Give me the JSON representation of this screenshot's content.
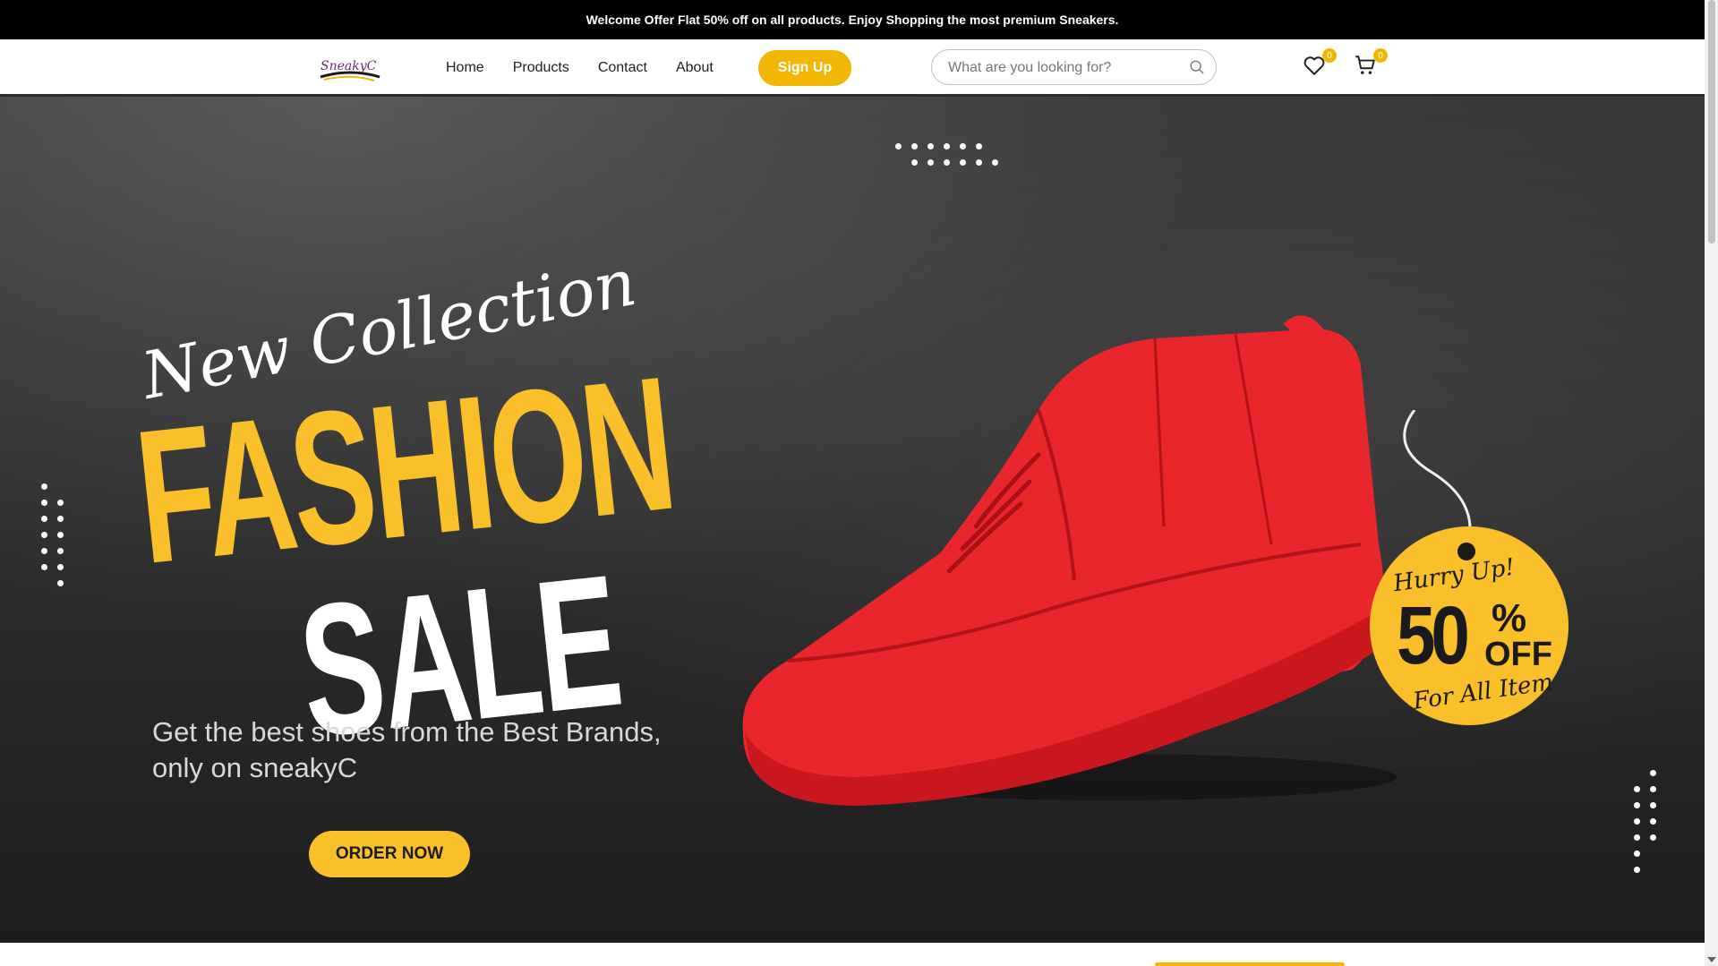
{
  "announcement": {
    "text": "Welcome Offer Flat 50% off on all products. Enjoy Shopping the most premium Sneakers."
  },
  "header": {
    "logo_text": "SneakyC",
    "nav": [
      {
        "label": "Home"
      },
      {
        "label": "Products"
      },
      {
        "label": "Contact"
      },
      {
        "label": "About"
      }
    ],
    "signup_label": "Sign Up",
    "search": {
      "placeholder": "What are you looking for?",
      "value": ""
    },
    "wishlist_count": "0",
    "cart_count": "0",
    "icons": {
      "wishlist": "heart-icon",
      "cart": "cart-icon",
      "search": "search-icon"
    }
  },
  "hero": {
    "script_title": "New Collection",
    "title_line1": "FASHION",
    "title_line2": "SALE",
    "subtitle": "Get the best shoes from the Best Brands, only on sneakyC",
    "cta_label": "ORDER NOW",
    "tag": {
      "hurry": "Hurry Up!",
      "amount": "50",
      "percent": "%",
      "off": "OFF",
      "scope": "For All Item"
    }
  },
  "colors": {
    "accent": "#f2b705",
    "hero_yellow": "#f9c02a",
    "shoe_red": "#e8262b",
    "topbar": "#000000"
  }
}
